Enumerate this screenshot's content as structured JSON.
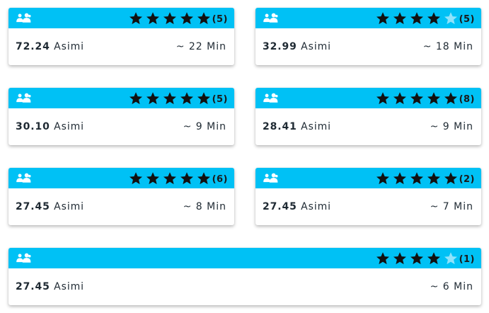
{
  "colors": {
    "header": "#00c1f5",
    "star_filled": "#111111",
    "star_empty": "#8fe3fb"
  },
  "icons": {
    "group": "users-icon",
    "rating": "star-icon"
  },
  "offers": [
    {
      "rating": 5,
      "reviews": "(5)",
      "price": "72.24",
      "currency": "Asimi",
      "time": "~ 22 Min"
    },
    {
      "rating": 4,
      "reviews": "(5)",
      "price": "32.99",
      "currency": "Asimi",
      "time": "~ 18 Min"
    },
    {
      "rating": 5,
      "reviews": "(5)",
      "price": "30.10",
      "currency": "Asimi",
      "time": "~ 9 Min"
    },
    {
      "rating": 5,
      "reviews": "(8)",
      "price": "28.41",
      "currency": "Asimi",
      "time": "~ 9 Min"
    },
    {
      "rating": 5,
      "reviews": "(6)",
      "price": "27.45",
      "currency": "Asimi",
      "time": "~ 8 Min"
    },
    {
      "rating": 5,
      "reviews": "(2)",
      "price": "27.45",
      "currency": "Asimi",
      "time": "~ 7 Min"
    },
    {
      "rating": 4,
      "reviews": "(1)",
      "price": "27.45",
      "currency": "Asimi",
      "time": "~ 6 Min"
    }
  ]
}
